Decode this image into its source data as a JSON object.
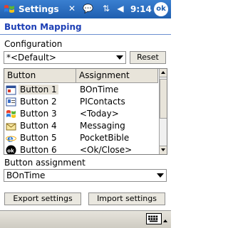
{
  "titlebar": {
    "title": "Settings",
    "time": "9:14",
    "ok_label": "ok"
  },
  "page": {
    "heading": "Button Mapping"
  },
  "configuration": {
    "label": "Configuration",
    "value": "*<Default>",
    "reset_label": "Reset"
  },
  "list": {
    "headers": [
      "Button",
      "Assignment"
    ],
    "rows": [
      {
        "button": "Button 1",
        "assignment": "BOnTime",
        "icon": "calendar-app-icon",
        "selected": true
      },
      {
        "button": "Button 2",
        "assignment": "PIContacts",
        "icon": "contacts-app-icon"
      },
      {
        "button": "Button 3",
        "assignment": "<Today>",
        "icon": "windows-flag-icon"
      },
      {
        "button": "Button 4",
        "assignment": "Messaging",
        "icon": "envelope-icon"
      },
      {
        "button": "Button 5",
        "assignment": "PocketBible",
        "icon": "internet-explorer-icon"
      },
      {
        "button": "Button 6",
        "assignment": "<Ok/Close>",
        "icon": "ok-circle-icon"
      }
    ]
  },
  "assignment": {
    "label": "Button assignment",
    "value": "BOnTime"
  },
  "actions": {
    "export_label": "Export settings",
    "import_label": "Import settings"
  }
}
